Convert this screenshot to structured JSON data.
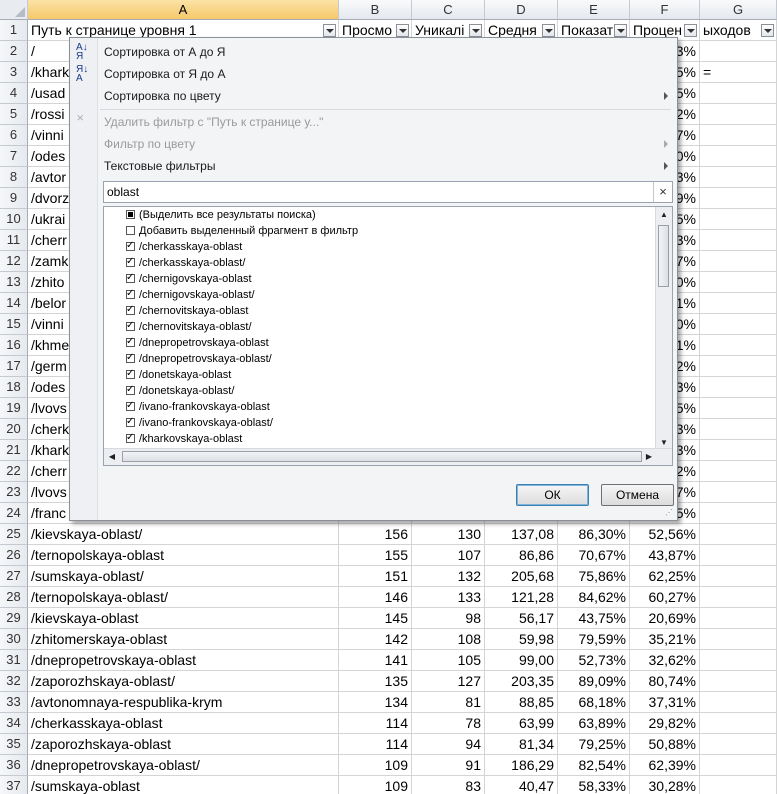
{
  "columns": [
    {
      "letter": "A",
      "header": "Путь к странице уровня 1",
      "filter": true
    },
    {
      "letter": "B",
      "header": "Просмо",
      "filter": true
    },
    {
      "letter": "C",
      "header": "Уникалі",
      "filter": true
    },
    {
      "letter": "D",
      "header": "Средня",
      "filter": true
    },
    {
      "letter": "E",
      "header": "Показат",
      "filter": true
    },
    {
      "letter": "F",
      "header": "Процен",
      "filter": true
    },
    {
      "letter": "G",
      "header": "ыходов",
      "filter": true
    }
  ],
  "hidden_rows": [
    {
      "n": "2",
      "a": "/",
      "f": "3%",
      "g": ""
    },
    {
      "n": "3",
      "a": "/khark",
      "f": "5%",
      "g": "="
    },
    {
      "n": "4",
      "a": "/usad",
      "f": "5%",
      "g": ""
    },
    {
      "n": "5",
      "a": "/rossi",
      "f": "2%",
      "g": ""
    },
    {
      "n": "6",
      "a": "/vinni",
      "f": "7%",
      "g": ""
    },
    {
      "n": "7",
      "a": "/odes",
      "f": "0%",
      "g": ""
    },
    {
      "n": "8",
      "a": "/avtor",
      "f": "3%",
      "g": ""
    },
    {
      "n": "9",
      "a": "/dvorz",
      "f": "9%",
      "g": ""
    },
    {
      "n": "10",
      "a": "/ukrai",
      "f": "5%",
      "g": ""
    },
    {
      "n": "11",
      "a": "/cherr",
      "f": "3%",
      "g": ""
    },
    {
      "n": "12",
      "a": "/zamk",
      "f": "7%",
      "g": ""
    },
    {
      "n": "13",
      "a": "/zhito",
      "f": "0%",
      "g": ""
    },
    {
      "n": "14",
      "a": "/belor",
      "f": "1%",
      "g": ""
    },
    {
      "n": "15",
      "a": "/vinni",
      "f": "0%",
      "g": ""
    },
    {
      "n": "16",
      "a": "/khme",
      "f": "1%",
      "g": ""
    },
    {
      "n": "17",
      "a": "/germ",
      "f": "2%",
      "g": ""
    },
    {
      "n": "18",
      "a": "/odes",
      "f": "3%",
      "g": ""
    },
    {
      "n": "19",
      "a": "/lvovs",
      "f": "5%",
      "g": ""
    },
    {
      "n": "20",
      "a": "/cherk",
      "f": "3%",
      "g": ""
    },
    {
      "n": "21",
      "a": "/khark",
      "f": "3%",
      "g": ""
    },
    {
      "n": "22",
      "a": "/cherr",
      "f": "2%",
      "g": ""
    },
    {
      "n": "23",
      "a": "/lvovs",
      "f": "7%",
      "g": ""
    },
    {
      "n": "24",
      "a": "/franc",
      "f": "5%",
      "g": ""
    }
  ],
  "rows": [
    {
      "n": "25",
      "a": "/kievskaya-oblast/",
      "b": "156",
      "c": "130",
      "d": "137,08",
      "e": "86,30%",
      "f": "52,56%"
    },
    {
      "n": "26",
      "a": "/ternopolskaya-oblast",
      "b": "155",
      "c": "107",
      "d": "86,86",
      "e": "70,67%",
      "f": "43,87%"
    },
    {
      "n": "27",
      "a": "/sumskaya-oblast/",
      "b": "151",
      "c": "132",
      "d": "205,68",
      "e": "75,86%",
      "f": "62,25%"
    },
    {
      "n": "28",
      "a": "/ternopolskaya-oblast/",
      "b": "146",
      "c": "133",
      "d": "121,28",
      "e": "84,62%",
      "f": "60,27%"
    },
    {
      "n": "29",
      "a": "/kievskaya-oblast",
      "b": "145",
      "c": "98",
      "d": "56,17",
      "e": "43,75%",
      "f": "20,69%"
    },
    {
      "n": "30",
      "a": "/zhitomerskaya-oblast",
      "b": "142",
      "c": "108",
      "d": "59,98",
      "e": "79,59%",
      "f": "35,21%"
    },
    {
      "n": "31",
      "a": "/dnepropetrovskaya-oblast",
      "b": "141",
      "c": "105",
      "d": "99,00",
      "e": "52,73%",
      "f": "32,62%"
    },
    {
      "n": "32",
      "a": "/zaporozhskaya-oblast/",
      "b": "135",
      "c": "127",
      "d": "203,35",
      "e": "89,09%",
      "f": "80,74%"
    },
    {
      "n": "33",
      "a": "/avtonomnaya-respublika-krym",
      "b": "134",
      "c": "81",
      "d": "88,85",
      "e": "68,18%",
      "f": "37,31%"
    },
    {
      "n": "34",
      "a": "/cherkasskaya-oblast",
      "b": "114",
      "c": "78",
      "d": "63,99",
      "e": "63,89%",
      "f": "29,82%"
    },
    {
      "n": "35",
      "a": "/zaporozhskaya-oblast",
      "b": "114",
      "c": "94",
      "d": "81,34",
      "e": "79,25%",
      "f": "50,88%"
    },
    {
      "n": "36",
      "a": "/dnepropetrovskaya-oblast/",
      "b": "109",
      "c": "91",
      "d": "186,29",
      "e": "82,54%",
      "f": "62,39%"
    },
    {
      "n": "37",
      "a": "/sumskaya-oblast",
      "b": "109",
      "c": "83",
      "d": "40,47",
      "e": "58,33%",
      "f": "30,28%"
    }
  ],
  "menu": {
    "sort_asc": "Сортировка от А до Я",
    "sort_desc": "Сортировка от Я до А",
    "sort_color": "Сортировка по цвету",
    "clear_filter": "Удалить фильтр с \"Путь к странице у...\"",
    "filter_color": "Фильтр по цвету",
    "text_filters": "Текстовые фильтры",
    "search_value": "oblast",
    "search_clear": "×",
    "items": [
      {
        "label": "(Выделить все результаты поиска)",
        "state": "part",
        "indent": false
      },
      {
        "label": "Добавить выделенный фрагмент в фильтр",
        "state": "off",
        "indent": false
      },
      {
        "label": "/cherkasskaya-oblast",
        "state": "on",
        "indent": true
      },
      {
        "label": "/cherkasskaya-oblast/",
        "state": "on",
        "indent": true
      },
      {
        "label": "/chernigovskaya-oblast",
        "state": "on",
        "indent": true
      },
      {
        "label": "/chernigovskaya-oblast/",
        "state": "on",
        "indent": true
      },
      {
        "label": "/chernovitskaya-oblast",
        "state": "on",
        "indent": true
      },
      {
        "label": "/chernovitskaya-oblast/",
        "state": "on",
        "indent": true
      },
      {
        "label": "/dnepropetrovskaya-oblast",
        "state": "on",
        "indent": true
      },
      {
        "label": "/dnepropetrovskaya-oblast/",
        "state": "on",
        "indent": true
      },
      {
        "label": "/donetskaya-oblast",
        "state": "on",
        "indent": true
      },
      {
        "label": "/donetskaya-oblast/",
        "state": "on",
        "indent": true
      },
      {
        "label": "/ivano-frankovskaya-oblast",
        "state": "on",
        "indent": true
      },
      {
        "label": "/ivano-frankovskaya-oblast/",
        "state": "on",
        "indent": true
      },
      {
        "label": "/kharkovskaya-oblast",
        "state": "on",
        "indent": true
      }
    ],
    "ok": "ОК",
    "cancel": "Отмена"
  }
}
